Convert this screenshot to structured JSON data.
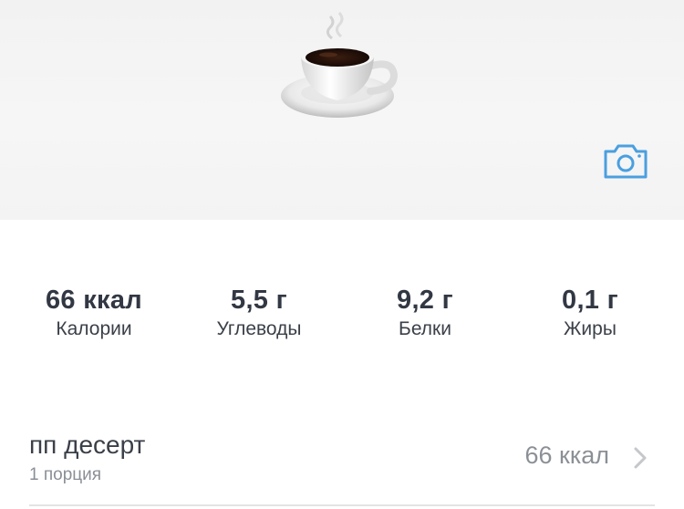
{
  "hero": {
    "image": "coffee-cup",
    "camera_icon": "camera-icon",
    "accent": "#4a9fe0"
  },
  "nutrition": [
    {
      "value": "66 ккал",
      "label": "Калории"
    },
    {
      "value": "5,5 г",
      "label": "Углеводы"
    },
    {
      "value": "9,2 г",
      "label": "Белки"
    },
    {
      "value": "0,1 г",
      "label": "Жиры"
    }
  ],
  "food": {
    "name": "пп десерт",
    "portion": "1 порция",
    "calories": "66 ккал"
  }
}
